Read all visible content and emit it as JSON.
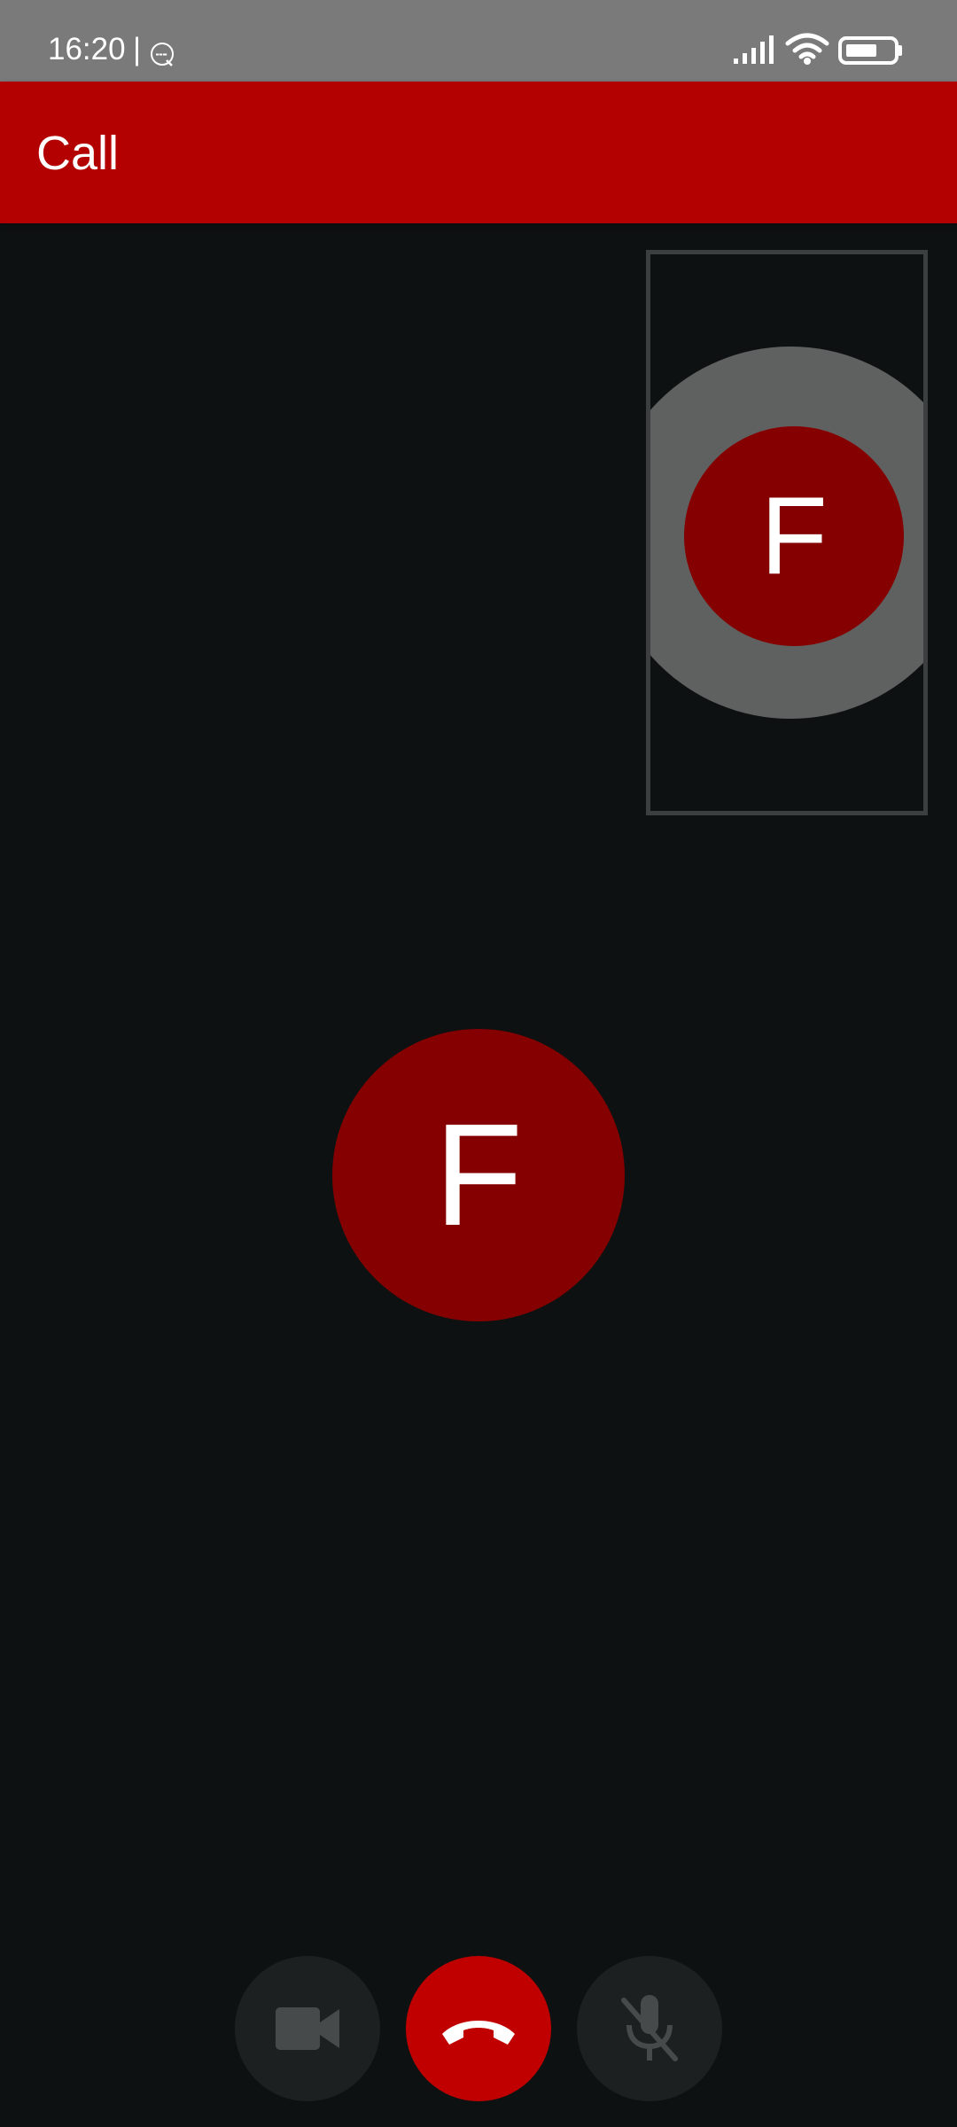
{
  "status_bar": {
    "time": "16:20",
    "separator": "|",
    "notification_icon": "pgp-key-icon",
    "icons": [
      "signal-icon",
      "wifi-icon",
      "battery-icon"
    ]
  },
  "app_bar": {
    "title": "Call",
    "color": "#b30000"
  },
  "self_preview": {
    "initial": "F"
  },
  "remote": {
    "initial": "F",
    "avatar_color": "#850000"
  },
  "controls": [
    {
      "name": "video-toggle",
      "icon": "video-camera-icon"
    },
    {
      "name": "hang-up",
      "icon": "phone-hangup-icon",
      "color": "#c00000"
    },
    {
      "name": "mute-toggle",
      "icon": "mic-off-icon"
    }
  ]
}
